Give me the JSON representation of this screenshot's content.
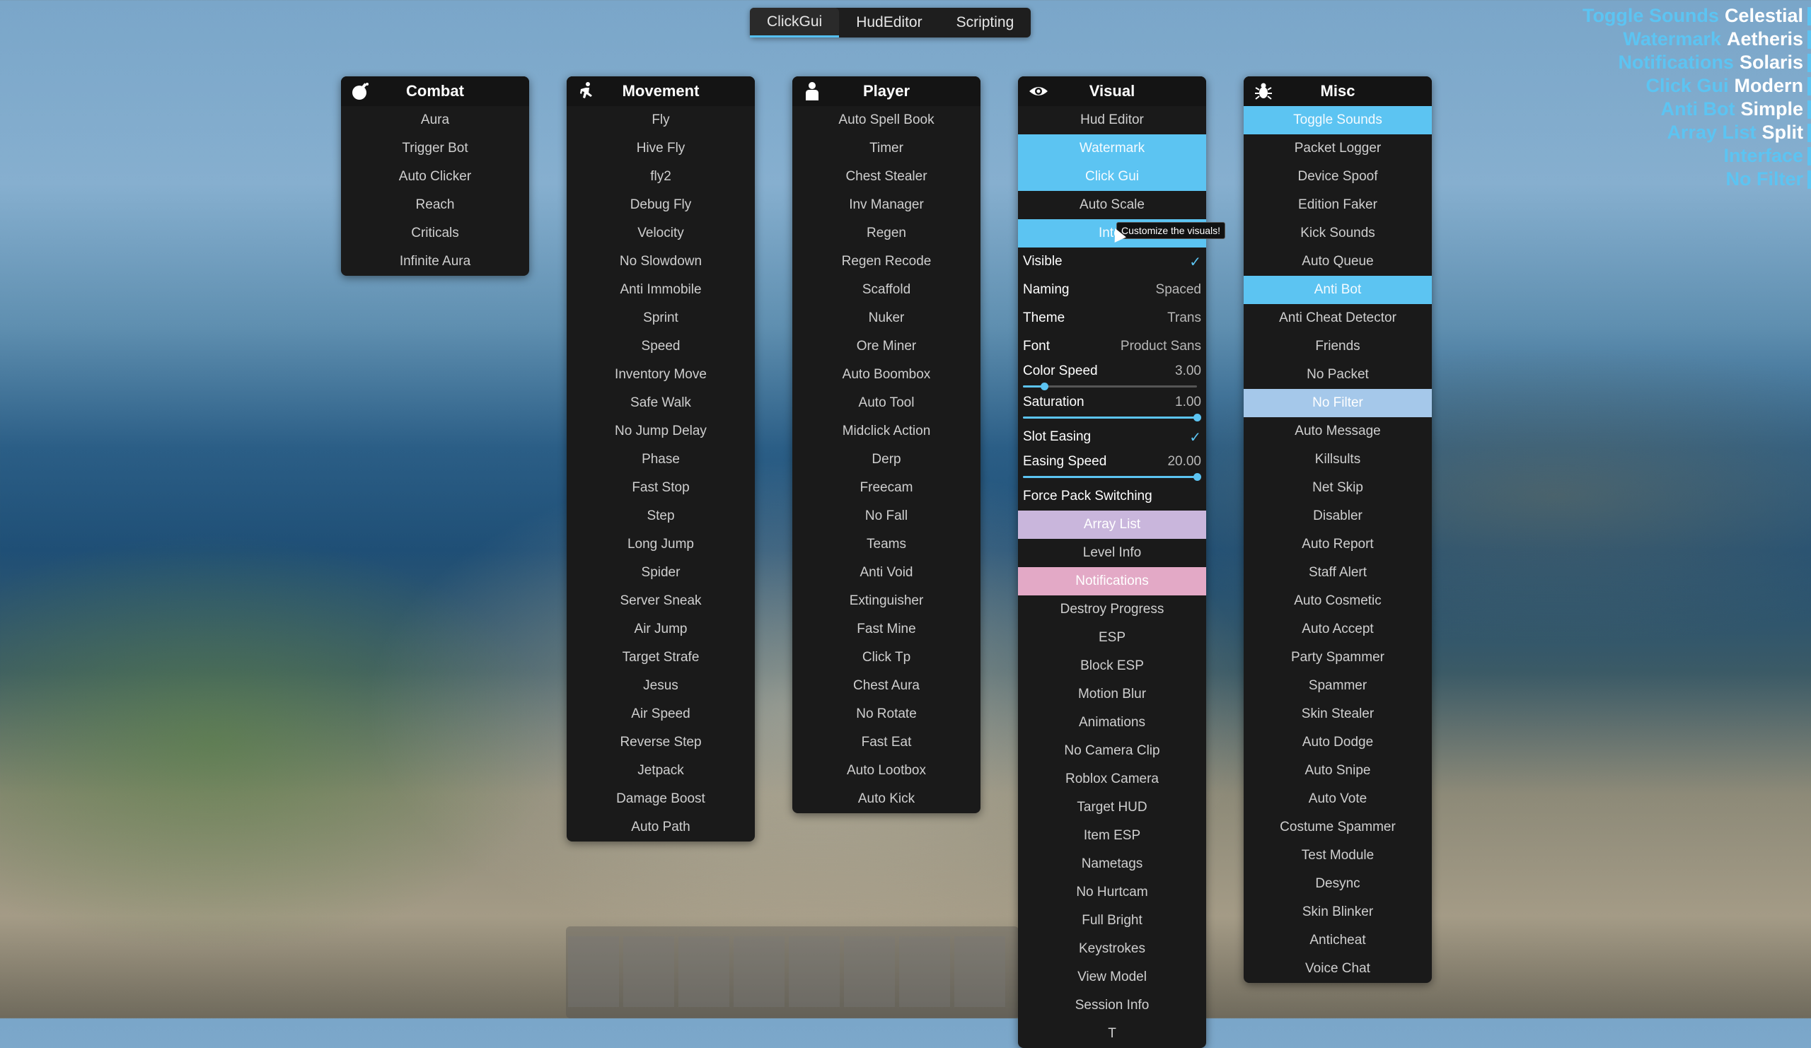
{
  "tabs": [
    {
      "label": "ClickGui",
      "active": true
    },
    {
      "label": "HudEditor",
      "active": false
    },
    {
      "label": "Scripting",
      "active": false
    }
  ],
  "panels": {
    "combat": {
      "title": "Combat",
      "icon": "bomb-icon",
      "items": [
        "Aura",
        "Trigger Bot",
        "Auto Clicker",
        "Reach",
        "Criticals",
        "Infinite Aura"
      ]
    },
    "movement": {
      "title": "Movement",
      "icon": "running-person-icon",
      "items": [
        "Fly",
        "Hive Fly",
        "fly2",
        "Debug Fly",
        "Velocity",
        "No Slowdown",
        "Anti Immobile",
        "Sprint",
        "Speed",
        "Inventory Move",
        "Safe Walk",
        "No Jump Delay",
        "Phase",
        "Fast Stop",
        "Step",
        "Long Jump",
        "Spider",
        "Server Sneak",
        "Air Jump",
        "Target Strafe",
        "Jesus",
        "Air Speed",
        "Reverse Step",
        "Jetpack",
        "Damage Boost",
        "Auto Path"
      ]
    },
    "player": {
      "title": "Player",
      "icon": "person-icon",
      "items": [
        "Auto Spell Book",
        "Timer",
        "Chest Stealer",
        "Inv Manager",
        "Regen",
        "Regen Recode",
        "Scaffold",
        "Nuker",
        "Ore Miner",
        "Auto Boombox",
        "Auto Tool",
        "Midclick Action",
        "Derp",
        "Freecam",
        "No Fall",
        "Teams",
        "Anti Void",
        "Extinguisher",
        "Fast Mine",
        "Click Tp",
        "Chest Aura",
        "No Rotate",
        "Fast Eat",
        "Auto Lootbox",
        "Auto Kick"
      ]
    },
    "visual": {
      "title": "Visual",
      "icon": "eye-icon",
      "top_items": [
        {
          "label": "Hud Editor",
          "state": "off"
        },
        {
          "label": "Watermark",
          "state": "on"
        },
        {
          "label": "Click Gui",
          "state": "on"
        },
        {
          "label": "Auto Scale",
          "state": "off"
        },
        {
          "label": "Inter",
          "state": "on"
        }
      ],
      "settings": {
        "visible": {
          "label": "Visible",
          "checked": true
        },
        "naming": {
          "label": "Naming",
          "value": "Spaced"
        },
        "theme": {
          "label": "Theme",
          "value": "Trans"
        },
        "font": {
          "label": "Font",
          "value": "Product Sans"
        },
        "color_speed": {
          "label": "Color Speed",
          "value": "3.00",
          "fraction": 0.12
        },
        "saturation": {
          "label": "Saturation",
          "value": "1.00",
          "fraction": 1.0
        },
        "slot_easing": {
          "label": "Slot Easing",
          "checked": true
        },
        "easing_speed": {
          "label": "Easing Speed",
          "value": "20.00",
          "fraction": 1.0
        },
        "force_pack": {
          "label": "Force Pack Switching"
        }
      },
      "bottom_items": [
        {
          "label": "Array List",
          "state": "lilac"
        },
        {
          "label": "Level Info",
          "state": "off"
        },
        {
          "label": "Notifications",
          "state": "pink"
        },
        {
          "label": "Destroy Progress",
          "state": "off"
        },
        {
          "label": "ESP",
          "state": "off"
        },
        {
          "label": "Block ESP",
          "state": "off"
        },
        {
          "label": "Motion Blur",
          "state": "off"
        },
        {
          "label": "Animations",
          "state": "off"
        },
        {
          "label": "No Camera Clip",
          "state": "off"
        },
        {
          "label": "Roblox Camera",
          "state": "off"
        },
        {
          "label": "Target HUD",
          "state": "off"
        },
        {
          "label": "Item ESP",
          "state": "off"
        },
        {
          "label": "Nametags",
          "state": "off"
        },
        {
          "label": "No Hurtcam",
          "state": "off"
        },
        {
          "label": "Full Bright",
          "state": "off"
        },
        {
          "label": "Keystrokes",
          "state": "off"
        },
        {
          "label": "View Model",
          "state": "off"
        },
        {
          "label": "Session Info",
          "state": "off"
        },
        {
          "label": "T",
          "state": "off"
        }
      ],
      "tooltip": "Customize the visuals!"
    },
    "misc": {
      "title": "Misc",
      "icon": "bug-icon",
      "items": [
        {
          "label": "Toggle Sounds",
          "state": "on"
        },
        {
          "label": "Packet Logger",
          "state": "off"
        },
        {
          "label": "Device Spoof",
          "state": "off"
        },
        {
          "label": "Edition Faker",
          "state": "off"
        },
        {
          "label": "Kick Sounds",
          "state": "off"
        },
        {
          "label": "Auto Queue",
          "state": "off"
        },
        {
          "label": "Anti Bot",
          "state": "on"
        },
        {
          "label": "Anti Cheat Detector",
          "state": "off"
        },
        {
          "label": "Friends",
          "state": "off"
        },
        {
          "label": "No Packet",
          "state": "off"
        },
        {
          "label": "No Filter",
          "state": "pale"
        },
        {
          "label": "Auto Message",
          "state": "off"
        },
        {
          "label": "Killsults",
          "state": "off"
        },
        {
          "label": "Net Skip",
          "state": "off"
        },
        {
          "label": "Disabler",
          "state": "off"
        },
        {
          "label": "Auto Report",
          "state": "off"
        },
        {
          "label": "Staff Alert",
          "state": "off"
        },
        {
          "label": "Auto Cosmetic",
          "state": "off"
        },
        {
          "label": "Auto Accept",
          "state": "off"
        },
        {
          "label": "Party Spammer",
          "state": "off"
        },
        {
          "label": "Spammer",
          "state": "off"
        },
        {
          "label": "Skin Stealer",
          "state": "off"
        },
        {
          "label": "Auto Dodge",
          "state": "off"
        },
        {
          "label": "Auto Snipe",
          "state": "off"
        },
        {
          "label": "Auto Vote",
          "state": "off"
        },
        {
          "label": "Costume Spammer",
          "state": "off"
        },
        {
          "label": "Test Module",
          "state": "off"
        },
        {
          "label": "Desync",
          "state": "off"
        },
        {
          "label": "Skin Blinker",
          "state": "off"
        },
        {
          "label": "Anticheat",
          "state": "off"
        },
        {
          "label": "Voice Chat",
          "state": "off"
        }
      ]
    }
  },
  "arraylist": [
    {
      "name": "Toggle Sounds",
      "suffix": "Celestial"
    },
    {
      "name": "Watermark",
      "suffix": "Aetheris"
    },
    {
      "name": "Notifications",
      "suffix": "Solaris"
    },
    {
      "name": "Click Gui",
      "suffix": "Modern"
    },
    {
      "name": "Anti Bot",
      "suffix": "Simple"
    },
    {
      "name": "Array List",
      "suffix": "Split"
    },
    {
      "name": "Interface",
      "suffix": ""
    },
    {
      "name": "No Filter",
      "suffix": ""
    }
  ],
  "colors": {
    "accent": "#5cc4f2",
    "panel": "#1a1a1a",
    "pink": "#e3a9c6",
    "lilac": "#c9b6dc"
  }
}
